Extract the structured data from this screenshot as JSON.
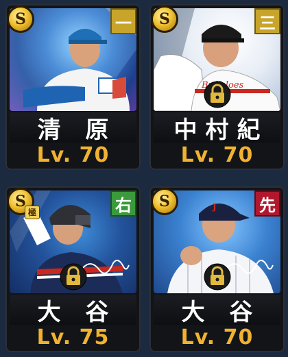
{
  "cards": [
    {
      "name": "清 原",
      "level": "Lv. 70",
      "rarity": "S",
      "slot": "一",
      "slot_color": "#c8a52a",
      "locked": false,
      "kiwami": false,
      "background": "blue-sparkle"
    },
    {
      "name": "中村紀",
      "level": "Lv. 70",
      "rarity": "S",
      "slot": "三",
      "slot_color": "#c8a52a",
      "locked": true,
      "kiwami": false,
      "background": "white"
    },
    {
      "name": "大 谷",
      "level": "Lv. 75",
      "rarity": "S",
      "kiwami_label": "極",
      "slot": "右",
      "slot_color": "#3b9a3b",
      "locked": true,
      "kiwami": true,
      "background": "navy"
    },
    {
      "name": "大 谷",
      "level": "Lv. 70",
      "rarity": "S",
      "slot": "先",
      "slot_color": "#b0182e",
      "locked": true,
      "kiwami": false,
      "background": "sky"
    }
  ],
  "icons": {
    "rarity": "gold-s-coin-icon",
    "lock": "padlock-icon",
    "signature": "autograph-icon"
  },
  "colors": {
    "level_text": "#f0b230",
    "name_text": "#ffffff",
    "page_background": "#1c2a3f"
  }
}
